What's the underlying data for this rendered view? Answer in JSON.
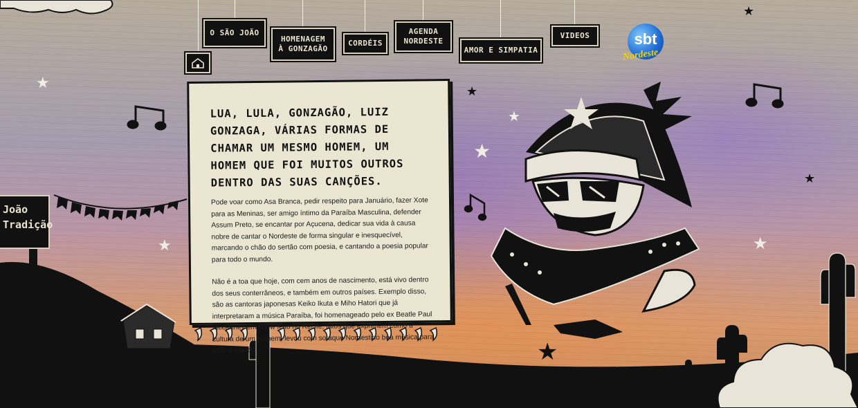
{
  "nav": {
    "home_icon": "house-icon",
    "items": [
      {
        "label": "O SÃO JOÃO"
      },
      {
        "label": "HOMENAGEM\nÀ GONZAGÃO"
      },
      {
        "label": "CORDÉIS"
      },
      {
        "label": "AGENDA\nNORDESTE"
      },
      {
        "label": "AMOR E SIMPATIA"
      },
      {
        "label": "VIDEOS"
      }
    ]
  },
  "logo": {
    "text": "sbt",
    "sub": "Nordeste"
  },
  "sign": {
    "line1": "João",
    "line2": "Tradição"
  },
  "article": {
    "headline": "Lua, Lula, Gonzagão, Luiz Gonzaga, várias formas de chamar um mesmo homem, um homem que foi muitos outros dentro das suas canções.",
    "paragraph1": "Pode voar como Asa Branca, pedir respeito para Januário, fazer Xote para as Meninas, ser amigo íntimo da Paraíba Masculina, defender Assum Preto, se encantar por Açucena, dedicar sua vida à causa nobre de cantar o Nordeste de forma singular e inesquecível, marcando o chão do sertão com poesia, e cantando a poesia popular para todo o mundo.",
    "paragraph2": "Não é a toa que hoje, com cem anos de nascimento, está vivo dentro dos seus conterrâneos, e também em outros países. Exemplo disso, são as cantoras japonesas Keiko Ikuta e Miho Hatori que já interpretaram a música Paraíba, foi homenageado pelo ex Beatle Paul Mccartney em show feito no Recife, fatos que exprimem como a cultura de um homem, levou com sotaque Nordestino boa música para todo o mundo."
  },
  "colors": {
    "ink": "#111111",
    "paper": "#ebe6d2",
    "brand_yellow": "#f2d400"
  }
}
